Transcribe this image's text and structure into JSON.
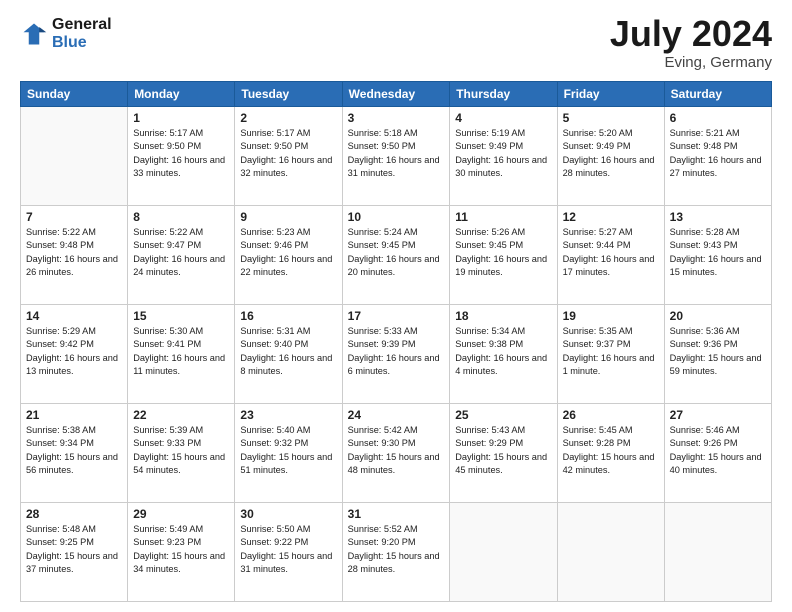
{
  "header": {
    "logo_line1": "General",
    "logo_line2": "Blue",
    "month": "July 2024",
    "location": "Eving, Germany"
  },
  "days_of_week": [
    "Sunday",
    "Monday",
    "Tuesday",
    "Wednesday",
    "Thursday",
    "Friday",
    "Saturday"
  ],
  "weeks": [
    [
      {
        "day": "",
        "sunrise": "",
        "sunset": "",
        "daylight": ""
      },
      {
        "day": "1",
        "sunrise": "Sunrise: 5:17 AM",
        "sunset": "Sunset: 9:50 PM",
        "daylight": "Daylight: 16 hours and 33 minutes."
      },
      {
        "day": "2",
        "sunrise": "Sunrise: 5:17 AM",
        "sunset": "Sunset: 9:50 PM",
        "daylight": "Daylight: 16 hours and 32 minutes."
      },
      {
        "day": "3",
        "sunrise": "Sunrise: 5:18 AM",
        "sunset": "Sunset: 9:50 PM",
        "daylight": "Daylight: 16 hours and 31 minutes."
      },
      {
        "day": "4",
        "sunrise": "Sunrise: 5:19 AM",
        "sunset": "Sunset: 9:49 PM",
        "daylight": "Daylight: 16 hours and 30 minutes."
      },
      {
        "day": "5",
        "sunrise": "Sunrise: 5:20 AM",
        "sunset": "Sunset: 9:49 PM",
        "daylight": "Daylight: 16 hours and 28 minutes."
      },
      {
        "day": "6",
        "sunrise": "Sunrise: 5:21 AM",
        "sunset": "Sunset: 9:48 PM",
        "daylight": "Daylight: 16 hours and 27 minutes."
      }
    ],
    [
      {
        "day": "7",
        "sunrise": "Sunrise: 5:22 AM",
        "sunset": "Sunset: 9:48 PM",
        "daylight": "Daylight: 16 hours and 26 minutes."
      },
      {
        "day": "8",
        "sunrise": "Sunrise: 5:22 AM",
        "sunset": "Sunset: 9:47 PM",
        "daylight": "Daylight: 16 hours and 24 minutes."
      },
      {
        "day": "9",
        "sunrise": "Sunrise: 5:23 AM",
        "sunset": "Sunset: 9:46 PM",
        "daylight": "Daylight: 16 hours and 22 minutes."
      },
      {
        "day": "10",
        "sunrise": "Sunrise: 5:24 AM",
        "sunset": "Sunset: 9:45 PM",
        "daylight": "Daylight: 16 hours and 20 minutes."
      },
      {
        "day": "11",
        "sunrise": "Sunrise: 5:26 AM",
        "sunset": "Sunset: 9:45 PM",
        "daylight": "Daylight: 16 hours and 19 minutes."
      },
      {
        "day": "12",
        "sunrise": "Sunrise: 5:27 AM",
        "sunset": "Sunset: 9:44 PM",
        "daylight": "Daylight: 16 hours and 17 minutes."
      },
      {
        "day": "13",
        "sunrise": "Sunrise: 5:28 AM",
        "sunset": "Sunset: 9:43 PM",
        "daylight": "Daylight: 16 hours and 15 minutes."
      }
    ],
    [
      {
        "day": "14",
        "sunrise": "Sunrise: 5:29 AM",
        "sunset": "Sunset: 9:42 PM",
        "daylight": "Daylight: 16 hours and 13 minutes."
      },
      {
        "day": "15",
        "sunrise": "Sunrise: 5:30 AM",
        "sunset": "Sunset: 9:41 PM",
        "daylight": "Daylight: 16 hours and 11 minutes."
      },
      {
        "day": "16",
        "sunrise": "Sunrise: 5:31 AM",
        "sunset": "Sunset: 9:40 PM",
        "daylight": "Daylight: 16 hours and 8 minutes."
      },
      {
        "day": "17",
        "sunrise": "Sunrise: 5:33 AM",
        "sunset": "Sunset: 9:39 PM",
        "daylight": "Daylight: 16 hours and 6 minutes."
      },
      {
        "day": "18",
        "sunrise": "Sunrise: 5:34 AM",
        "sunset": "Sunset: 9:38 PM",
        "daylight": "Daylight: 16 hours and 4 minutes."
      },
      {
        "day": "19",
        "sunrise": "Sunrise: 5:35 AM",
        "sunset": "Sunset: 9:37 PM",
        "daylight": "Daylight: 16 hours and 1 minute."
      },
      {
        "day": "20",
        "sunrise": "Sunrise: 5:36 AM",
        "sunset": "Sunset: 9:36 PM",
        "daylight": "Daylight: 15 hours and 59 minutes."
      }
    ],
    [
      {
        "day": "21",
        "sunrise": "Sunrise: 5:38 AM",
        "sunset": "Sunset: 9:34 PM",
        "daylight": "Daylight: 15 hours and 56 minutes."
      },
      {
        "day": "22",
        "sunrise": "Sunrise: 5:39 AM",
        "sunset": "Sunset: 9:33 PM",
        "daylight": "Daylight: 15 hours and 54 minutes."
      },
      {
        "day": "23",
        "sunrise": "Sunrise: 5:40 AM",
        "sunset": "Sunset: 9:32 PM",
        "daylight": "Daylight: 15 hours and 51 minutes."
      },
      {
        "day": "24",
        "sunrise": "Sunrise: 5:42 AM",
        "sunset": "Sunset: 9:30 PM",
        "daylight": "Daylight: 15 hours and 48 minutes."
      },
      {
        "day": "25",
        "sunrise": "Sunrise: 5:43 AM",
        "sunset": "Sunset: 9:29 PM",
        "daylight": "Daylight: 15 hours and 45 minutes."
      },
      {
        "day": "26",
        "sunrise": "Sunrise: 5:45 AM",
        "sunset": "Sunset: 9:28 PM",
        "daylight": "Daylight: 15 hours and 42 minutes."
      },
      {
        "day": "27",
        "sunrise": "Sunrise: 5:46 AM",
        "sunset": "Sunset: 9:26 PM",
        "daylight": "Daylight: 15 hours and 40 minutes."
      }
    ],
    [
      {
        "day": "28",
        "sunrise": "Sunrise: 5:48 AM",
        "sunset": "Sunset: 9:25 PM",
        "daylight": "Daylight: 15 hours and 37 minutes."
      },
      {
        "day": "29",
        "sunrise": "Sunrise: 5:49 AM",
        "sunset": "Sunset: 9:23 PM",
        "daylight": "Daylight: 15 hours and 34 minutes."
      },
      {
        "day": "30",
        "sunrise": "Sunrise: 5:50 AM",
        "sunset": "Sunset: 9:22 PM",
        "daylight": "Daylight: 15 hours and 31 minutes."
      },
      {
        "day": "31",
        "sunrise": "Sunrise: 5:52 AM",
        "sunset": "Sunset: 9:20 PM",
        "daylight": "Daylight: 15 hours and 28 minutes."
      },
      {
        "day": "",
        "sunrise": "",
        "sunset": "",
        "daylight": ""
      },
      {
        "day": "",
        "sunrise": "",
        "sunset": "",
        "daylight": ""
      },
      {
        "day": "",
        "sunrise": "",
        "sunset": "",
        "daylight": ""
      }
    ]
  ]
}
